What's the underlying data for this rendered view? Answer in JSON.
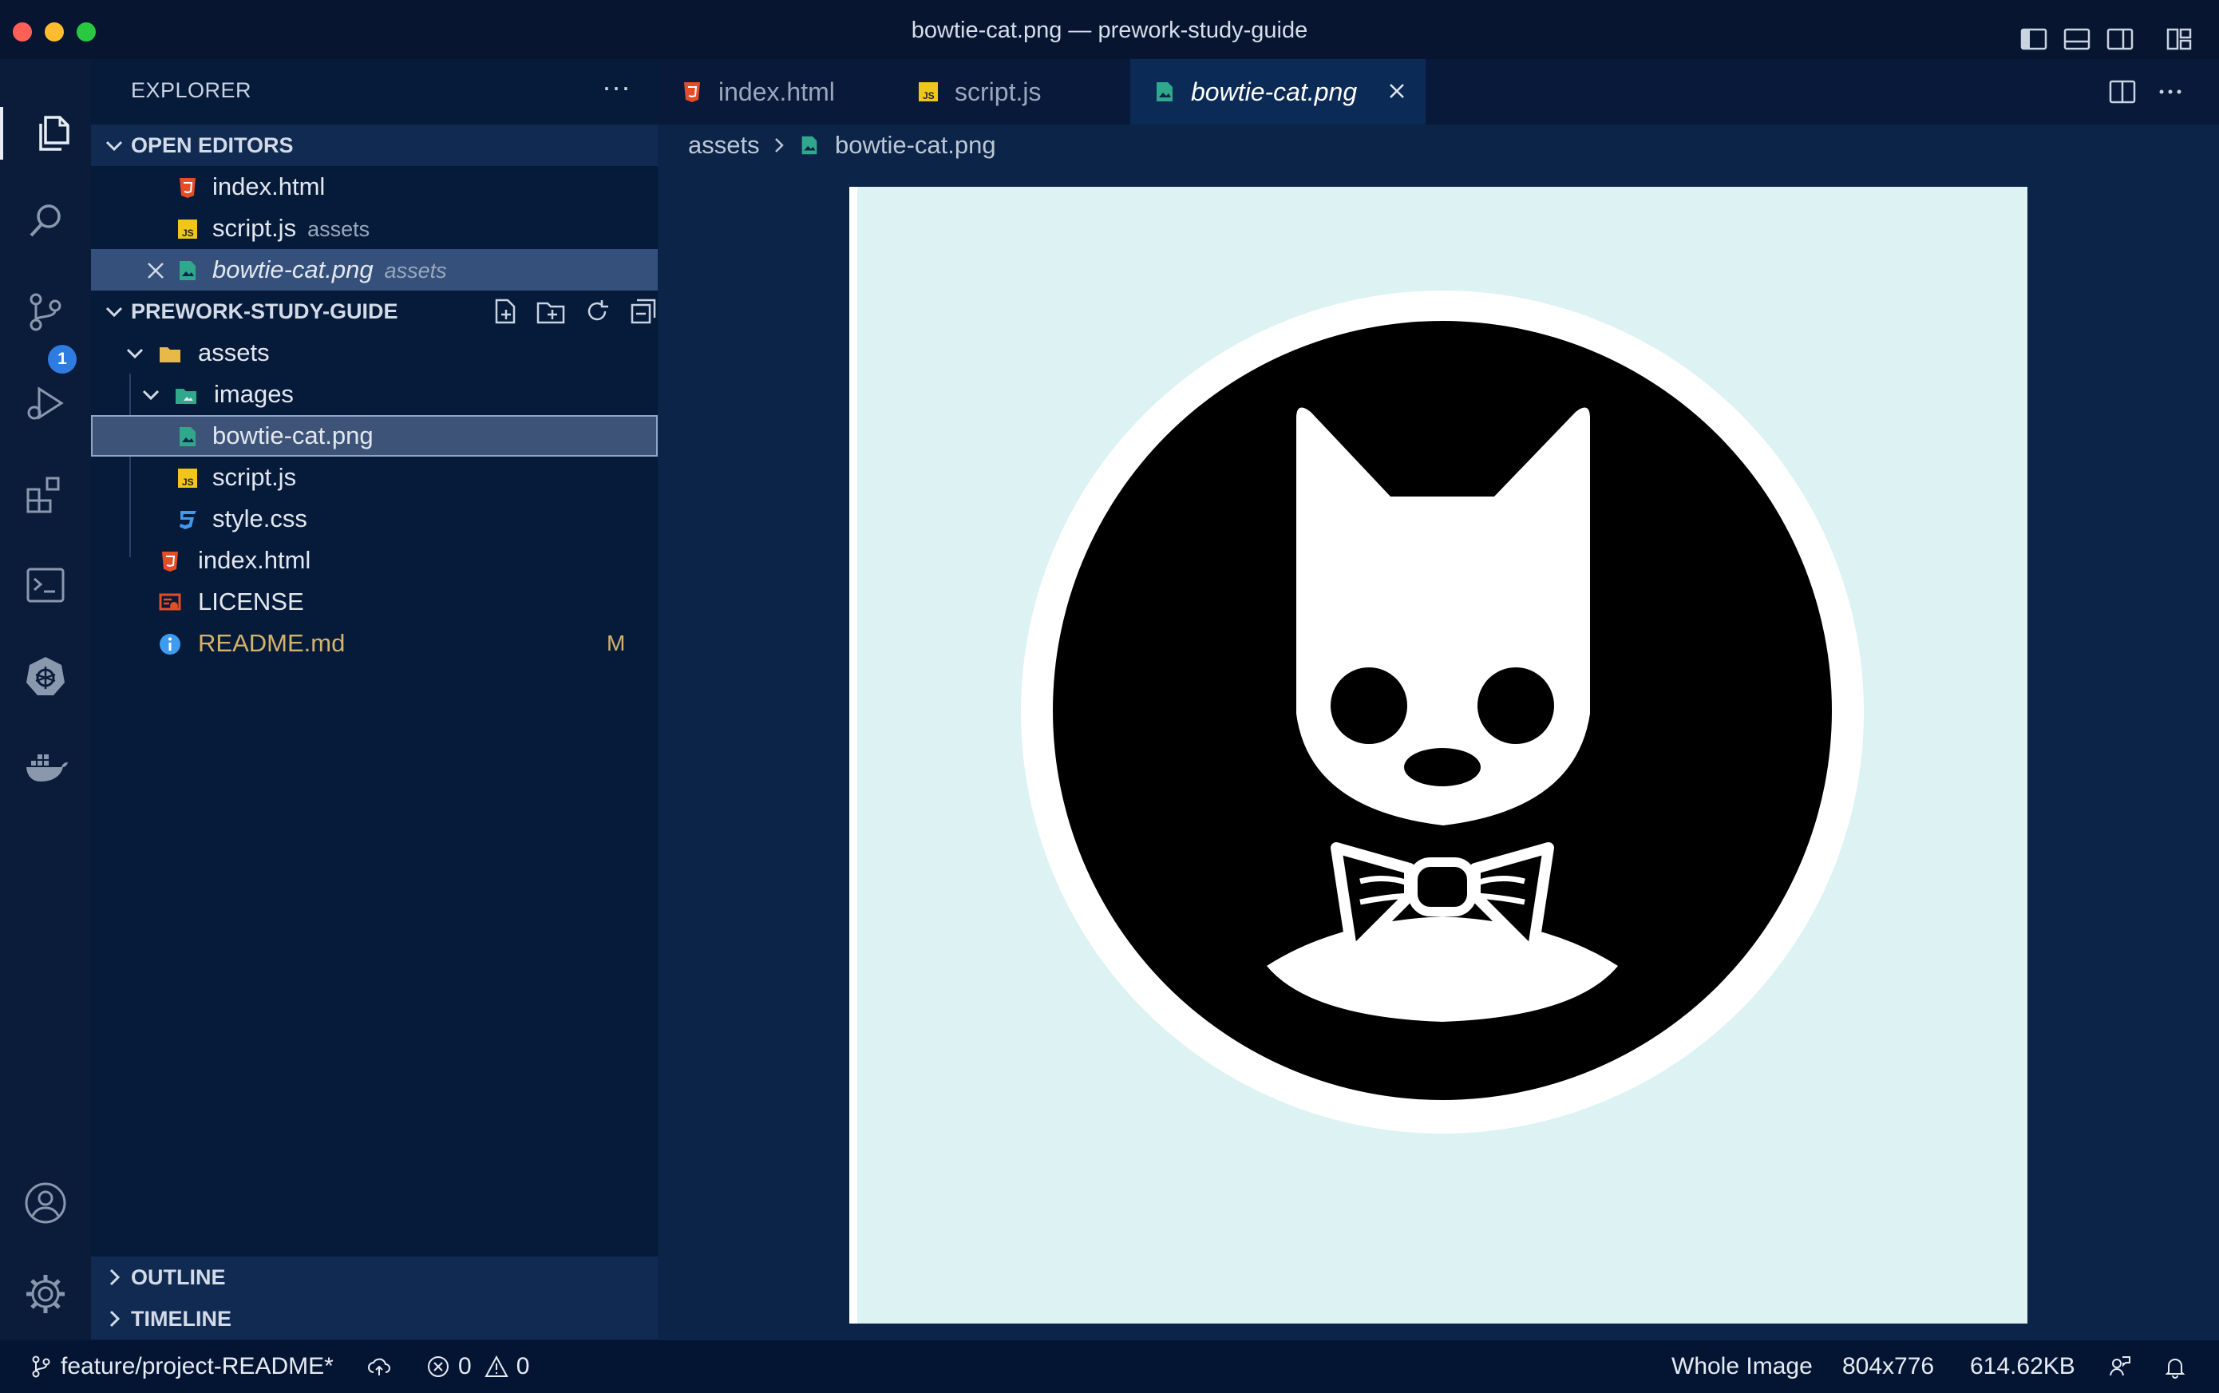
{
  "window": {
    "title": "bowtie-cat.png — prework-study-guide"
  },
  "activity_bar": {
    "items": [
      "explorer",
      "search",
      "source-control",
      "run-debug",
      "extensions",
      "terminal",
      "kubernetes",
      "docker",
      "accounts",
      "settings"
    ],
    "source_control_badge": "1"
  },
  "sidebar": {
    "title": "EXPLORER",
    "more": "···",
    "open_editors": {
      "header": "OPEN EDITORS",
      "items": [
        {
          "name": "index.html",
          "desc": ""
        },
        {
          "name": "script.js",
          "desc": "assets"
        },
        {
          "name": "bowtie-cat.png",
          "desc": "assets"
        }
      ]
    },
    "workspace": {
      "header": "PREWORK-STUDY-GUIDE",
      "tree": [
        {
          "name": "assets"
        },
        {
          "name": "images"
        },
        {
          "name": "bowtie-cat.png"
        },
        {
          "name": "script.js"
        },
        {
          "name": "style.css"
        },
        {
          "name": "index.html"
        },
        {
          "name": "LICENSE"
        },
        {
          "name": "README.md",
          "status": "M"
        }
      ]
    },
    "outline": "OUTLINE",
    "timeline": "TIMELINE"
  },
  "tabs": [
    {
      "label": "index.html"
    },
    {
      "label": "script.js"
    },
    {
      "label": "bowtie-cat.png"
    }
  ],
  "breadcrumb": {
    "folder": "assets",
    "file": "bowtie-cat.png"
  },
  "statusbar": {
    "branch": "feature/project-README*",
    "errors": "0",
    "warnings": "0",
    "zoom": "Whole Image",
    "dimensions": "804x776",
    "size": "614.62KB"
  },
  "colors": {
    "html_icon": "#e44d26",
    "js_icon": "#f0c61a",
    "css_icon": "#3e9bf0",
    "image_icon": "#2fa88c",
    "modified": "#d4b36a"
  }
}
